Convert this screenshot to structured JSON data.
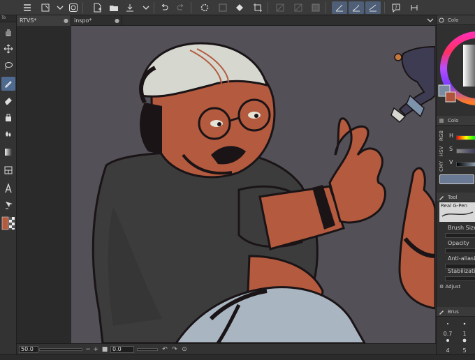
{
  "toolbar": {
    "icons": [
      "menu-icon",
      "new-canvas-icon",
      "dropdown-icon",
      "quick-access-icon",
      "new-file-icon",
      "open-folder-icon",
      "save-icon",
      "export-icon",
      "dropdown-icon",
      "undo-icon",
      "redo-icon",
      "loading-spinner-icon",
      "transform-icon",
      "fill-icon",
      "crop-icon",
      "grid-icon",
      "layer-icon",
      "mask-icon",
      "stabilizer-1-icon",
      "stabilizer-2-icon",
      "stabilizer-3-icon",
      "help-icon",
      "account-icon"
    ]
  },
  "tools_panel": {
    "tab_label": "To",
    "tools": [
      "hand",
      "move",
      "lasso",
      "pen",
      "eraser",
      "fill-bucket",
      "blend",
      "gradient",
      "frame",
      "text",
      "operation"
    ],
    "active_tool": "pen",
    "main_color": "#b45a3e",
    "sub_color": "transparent"
  },
  "documents": {
    "tabs": [
      {
        "label": "RTVS*",
        "active": true
      },
      {
        "label": "inspo*",
        "active": false
      }
    ]
  },
  "status": {
    "zoom": "50.0",
    "angle": "0.0"
  },
  "color_wheel_panel": {
    "title": "Colo",
    "main_swatch": "#7a8aa0",
    "sub_swatch": "#b0533c"
  },
  "color_slider_panel": {
    "title": "Colo",
    "tabs": [
      "RGB",
      "HSV",
      "CMY"
    ],
    "labels": [
      "H",
      "S",
      "V"
    ],
    "preview_color": "#6a7a95"
  },
  "tool_property_panel": {
    "title": "Tool",
    "brush_name": "Real G-Pen",
    "properties": [
      "Brush Size",
      "Opacity",
      "Anti-aliasing",
      "Stabilization"
    ],
    "footer": "Adjust"
  },
  "brush_size_panel": {
    "title": "Brus",
    "values": [
      "0.7",
      "1",
      "4",
      "5"
    ]
  },
  "colors": {
    "canvas_bg": "#535157",
    "skin": "#b45a3e",
    "shirt": "#3c3c3c",
    "cap": "#d6d8d0",
    "jeans": "#a9b6c2",
    "line": "#1a1416",
    "accent": "#4f6a90"
  }
}
